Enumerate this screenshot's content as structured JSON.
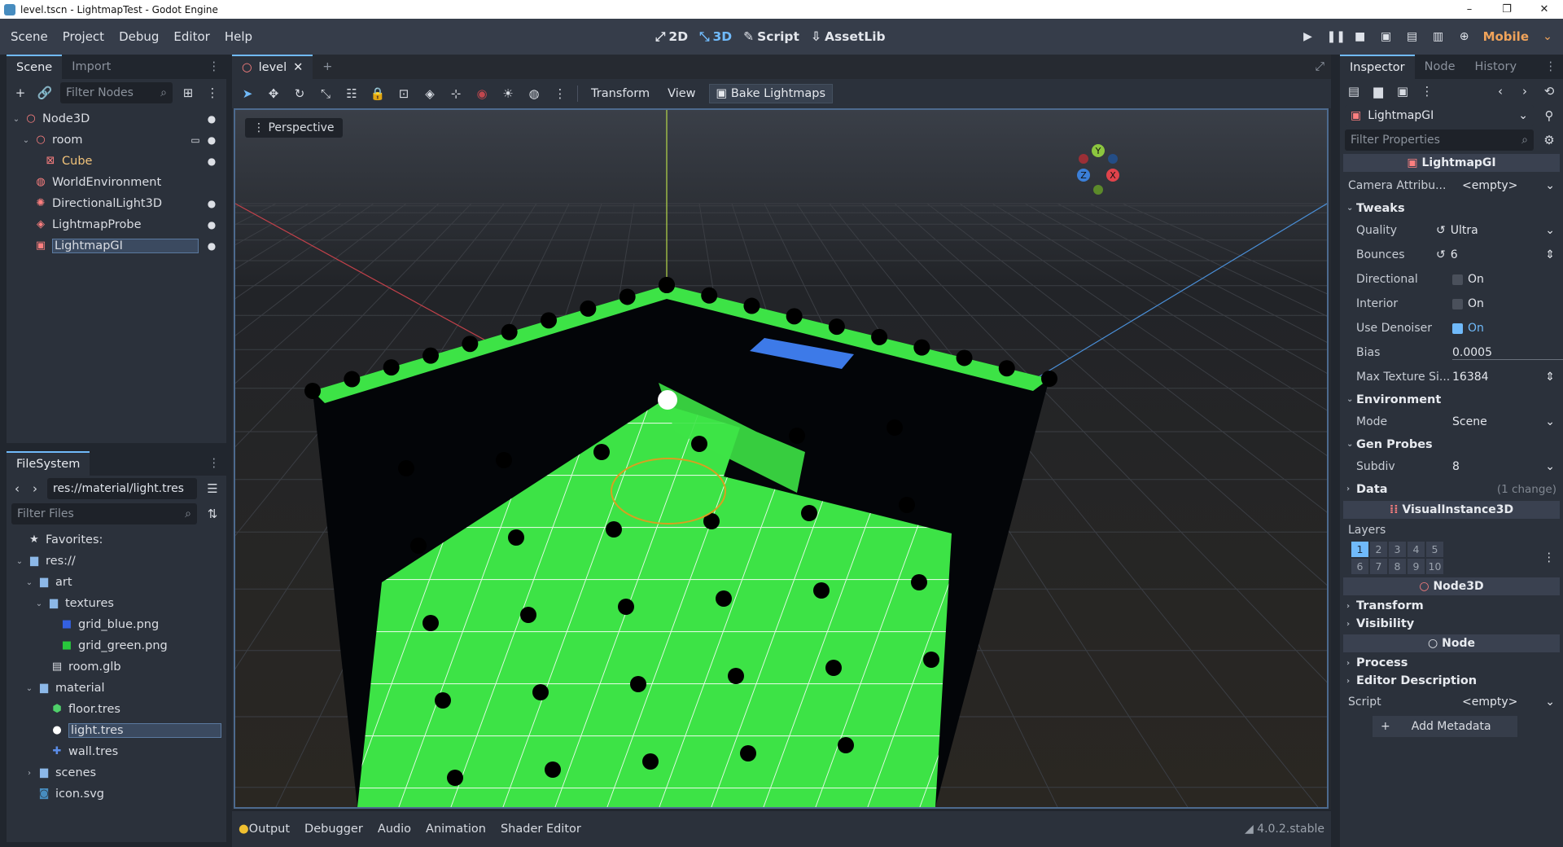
{
  "window": {
    "title": "level.tscn - LightmapTest - Godot Engine",
    "controls": [
      "–",
      "❐",
      "✕"
    ]
  },
  "menubar": {
    "menus": [
      "Scene",
      "Project",
      "Debug",
      "Editor",
      "Help"
    ],
    "modes": [
      {
        "label": "2D",
        "icon": "2d-icon"
      },
      {
        "label": "3D",
        "icon": "3d-icon"
      },
      {
        "label": "Script",
        "icon": "script-icon"
      },
      {
        "label": "AssetLib",
        "icon": "assetlib-icon"
      }
    ],
    "renderer": "Mobile"
  },
  "scene_dock": {
    "tabs": [
      "Scene",
      "Import"
    ],
    "filter_placeholder": "Filter Nodes",
    "nodes": [
      {
        "label": "Node3D",
        "icon": "node3d-icon",
        "color": "#fc7f7f",
        "visible_toggle": true
      },
      {
        "label": "room",
        "icon": "node3d-icon",
        "color": "#fc7f7f",
        "visible_toggle": true
      },
      {
        "label": "Cube",
        "icon": "mesh-icon",
        "color": "#fc7f7f",
        "visible_toggle": true
      },
      {
        "label": "WorldEnvironment",
        "icon": "world-icon",
        "color": "#fc7f7f",
        "visible_toggle": false
      },
      {
        "label": "DirectionalLight3D",
        "icon": "light-icon",
        "color": "#fc7f7f",
        "visible_toggle": true
      },
      {
        "label": "LightmapProbe",
        "icon": "probe-icon",
        "color": "#fc7f7f",
        "visible_toggle": true
      },
      {
        "label": "LightmapGI",
        "icon": "lightmap-icon",
        "color": "#fc7f7f",
        "visible_toggle": true
      }
    ]
  },
  "filesystem_dock": {
    "tab": "FileSystem",
    "path": "res://material/light.tres",
    "filter_placeholder": "Filter Files",
    "items": [
      {
        "label": "Favorites:",
        "icon": "star-icon"
      },
      {
        "label": "res://",
        "icon": "folder-icon"
      },
      {
        "label": "art",
        "icon": "folder-icon"
      },
      {
        "label": "textures",
        "icon": "folder-icon"
      },
      {
        "label": "grid_blue.png",
        "icon": "image-icon"
      },
      {
        "label": "grid_green.png",
        "icon": "image-icon"
      },
      {
        "label": "room.glb",
        "icon": "scene-icon"
      },
      {
        "label": "material",
        "icon": "folder-icon"
      },
      {
        "label": "floor.tres",
        "icon": "resource-icon"
      },
      {
        "label": "light.tres",
        "icon": "resource-icon"
      },
      {
        "label": "wall.tres",
        "icon": "resource-icon"
      },
      {
        "label": "scenes",
        "icon": "folder-icon"
      },
      {
        "label": "icon.svg",
        "icon": "svg-icon"
      }
    ]
  },
  "viewport": {
    "tab": "level",
    "toolbar_text": [
      "Transform",
      "View"
    ],
    "bake_label": "Bake Lightmaps",
    "perspective_label": "Perspective",
    "gizmo": {
      "x": "X",
      "y": "Y",
      "z": "Z"
    }
  },
  "bottom_panel": {
    "tabs": [
      "Output",
      "Debugger",
      "Audio",
      "Animation",
      "Shader Editor"
    ],
    "version": "4.0.2.stable"
  },
  "inspector": {
    "tabs": [
      "Inspector",
      "Node",
      "History"
    ],
    "node_label": "LightmapGI",
    "filter_placeholder": "Filter Properties",
    "section_lightmapgi": "LightmapGI",
    "camera_attr": {
      "name": "Camera Attribu...",
      "value": "<empty>"
    },
    "tweaks": {
      "title": "Tweaks",
      "quality": {
        "name": "Quality",
        "value": "Ultra"
      },
      "bounces": {
        "name": "Bounces",
        "value": "6"
      },
      "directional": {
        "name": "Directional",
        "value": "On",
        "checked": false
      },
      "interior": {
        "name": "Interior",
        "value": "On",
        "checked": false
      },
      "denoiser": {
        "name": "Use Denoiser",
        "value": "On",
        "checked": true
      },
      "bias": {
        "name": "Bias",
        "value": "0.0005"
      },
      "max_texture": {
        "name": "Max Texture Si...",
        "value": "16384"
      }
    },
    "environment": {
      "title": "Environment",
      "mode_name": "Mode",
      "mode_value": "Scene"
    },
    "gen_probes": {
      "title": "Gen Probes",
      "subdiv_name": "Subdiv",
      "subdiv_value": "8"
    },
    "data": {
      "title": "Data",
      "change": "(1 change)"
    },
    "section_visual": "VisualInstance3D",
    "layers": {
      "title": "Layers",
      "values": [
        "1",
        "2",
        "3",
        "4",
        "5",
        "6",
        "7",
        "8",
        "9",
        "10"
      ],
      "active": [
        1
      ]
    },
    "section_node3d": "Node3D",
    "transform": "Transform",
    "visibility": "Visibility",
    "section_node": "Node",
    "process": "Process",
    "editor_description": "Editor Description",
    "script": {
      "name": "Script",
      "value": "<empty>"
    },
    "add_metadata": "Add Metadata"
  }
}
